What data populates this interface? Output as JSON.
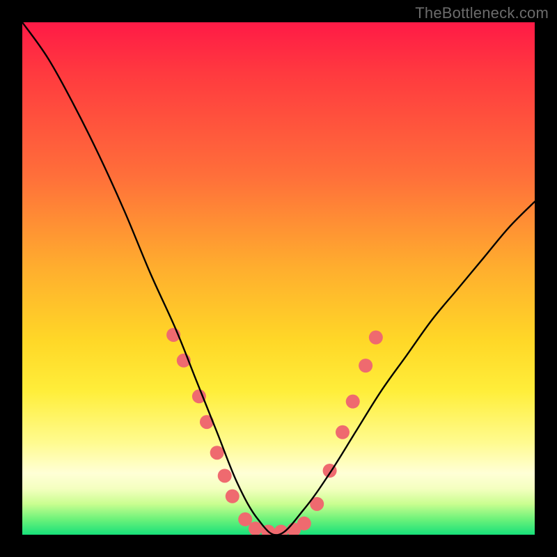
{
  "watermark": "TheBottleneck.com",
  "chart_data": {
    "type": "line",
    "title": "",
    "xlabel": "",
    "ylabel": "",
    "xlim": [
      0,
      100
    ],
    "ylim": [
      0,
      100
    ],
    "grid": false,
    "series": [
      {
        "name": "bottleneck-curve",
        "x": [
          0,
          5,
          10,
          15,
          20,
          25,
          30,
          34,
          38,
          42,
          46,
          50,
          55,
          60,
          65,
          70,
          75,
          80,
          85,
          90,
          95,
          100
        ],
        "values": [
          100,
          93,
          84,
          74,
          63,
          51,
          40,
          30,
          20,
          10,
          3,
          0,
          5,
          12,
          20,
          28,
          35,
          42,
          48,
          54,
          60,
          65
        ]
      }
    ],
    "markers": {
      "name": "confidence-dots",
      "color": "#ef6a6f",
      "radius": 10,
      "points": [
        {
          "x": 29.5,
          "y": 39
        },
        {
          "x": 31.5,
          "y": 34
        },
        {
          "x": 34.5,
          "y": 27
        },
        {
          "x": 36.0,
          "y": 22
        },
        {
          "x": 38.0,
          "y": 16
        },
        {
          "x": 39.5,
          "y": 11.5
        },
        {
          "x": 41.0,
          "y": 7.5
        },
        {
          "x": 43.5,
          "y": 3.0
        },
        {
          "x": 45.5,
          "y": 1.2
        },
        {
          "x": 48.0,
          "y": 0.6
        },
        {
          "x": 50.5,
          "y": 0.6
        },
        {
          "x": 53.0,
          "y": 1.0
        },
        {
          "x": 55.0,
          "y": 2.2
        },
        {
          "x": 57.5,
          "y": 6.0
        },
        {
          "x": 60.0,
          "y": 12.5
        },
        {
          "x": 62.5,
          "y": 20.0
        },
        {
          "x": 64.5,
          "y": 26.0
        },
        {
          "x": 67.0,
          "y": 33.0
        },
        {
          "x": 69.0,
          "y": 38.5
        }
      ]
    },
    "gradient_stops": [
      {
        "pos": 0,
        "color": "#ff1a46"
      },
      {
        "pos": 10,
        "color": "#ff3a3f"
      },
      {
        "pos": 30,
        "color": "#ff6f3a"
      },
      {
        "pos": 48,
        "color": "#ffae2e"
      },
      {
        "pos": 62,
        "color": "#ffd727"
      },
      {
        "pos": 72,
        "color": "#ffee3a"
      },
      {
        "pos": 82,
        "color": "#fffb8f"
      },
      {
        "pos": 88,
        "color": "#ffffd6"
      },
      {
        "pos": 91,
        "color": "#f4ffc0"
      },
      {
        "pos": 94,
        "color": "#c9fe90"
      },
      {
        "pos": 97,
        "color": "#6cf27a"
      },
      {
        "pos": 100,
        "color": "#17e07a"
      }
    ]
  }
}
